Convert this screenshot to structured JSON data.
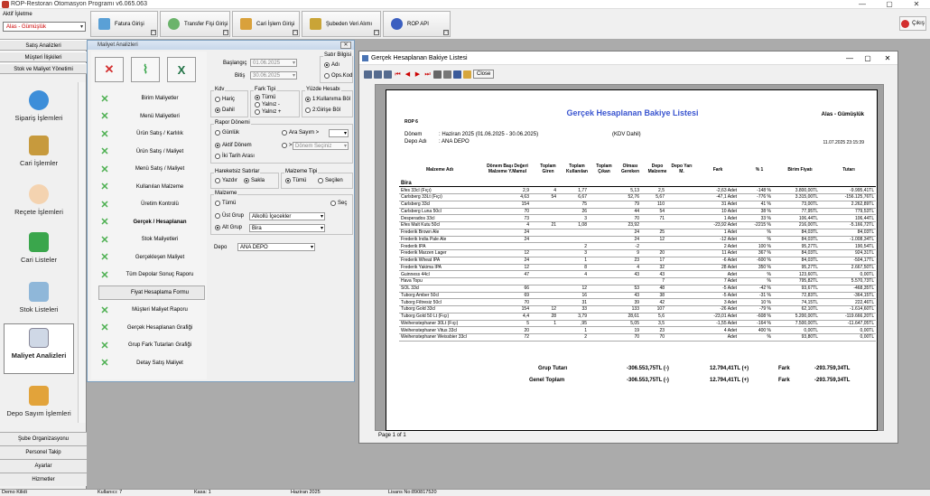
{
  "app": {
    "title": "ROP-Restoran Otomasyon Programı v6.065.063",
    "min_icon": "—",
    "max_icon": "▢",
    "close_icon": "✕"
  },
  "topbar": {
    "branch_label": "Aktif İşletme",
    "branch_value": "Alas - Gümüşlük",
    "buttons": [
      "Fatura Girişi",
      "Transfer Fişi Girişi",
      "Cari İşlem Girişi",
      "Şubeden Veri Alımı",
      "ROP API"
    ],
    "exit": "Çıkış"
  },
  "left": {
    "headers": [
      "Satış Analizleri",
      "Müşteri İlişkileri",
      "Stok ve Maliyet Yönetimi"
    ],
    "modules": [
      "Sipariş İşlemleri",
      "Cari İşlemler",
      "Reçete İşlemleri",
      "Cari Listeler",
      "Stok Listeleri",
      "Maliyet Analizleri",
      "Depo Sayım İşlemleri"
    ],
    "bottom": [
      "Şube Organizasyonu",
      "Personel Takip",
      "Ayarlar",
      "Hizmetler"
    ]
  },
  "dialog": {
    "title": "Maliyet Analizleri",
    "menu": [
      "Birim Maliyetler",
      "Menü Maliyetleri",
      "Ürün Satış / Karlılık",
      "Ürün Satış / Maliyet",
      "Menü Satış / Maliyet",
      "Kullanılan Malzeme",
      "Üretim Kontrolü",
      "Gerçek / Hesaplanan",
      "Stok Maliyetleri",
      "Gerçekleşen Maliyet",
      "Tüm Depolar Sonuç Raporu",
      "Fiyat Hesaplama Formu",
      "Müşteri Maliyet Raporu",
      "Gerçek Hesaplanan Grafiği",
      "Grup Fark Tutarları Grafiği",
      "Detay Satış Maliyet"
    ],
    "baslangic_label": "Başlangıç",
    "baslangic": "01.06.2025",
    "bitis_label": "Bitiş",
    "bitis": "30.06.2025",
    "satir_bilgisi": "Satır Bilgisi",
    "adi": "Adı",
    "ops_kod": "Ops.Kod",
    "kdv": "Kdv",
    "haric": "Hariç",
    "dahil": "Dahil",
    "fark_tipi": "Fark Tipi",
    "tumu": "Tümü",
    "yalniz_minus": "Yalnız -",
    "yalniz_plus": "Yalnız +",
    "yuzde": "Yüzde Hesabı",
    "kullanima": "1:Kullanıma Böl",
    "girise": "2:Girişe Böl",
    "rapor_donemi": "Rapor Dönemi",
    "gunluk": "Günlük",
    "ara_sayim": "Ara Sayım >",
    "aktif_donem": "Aktif Dönem",
    "donem_seciniz": "Dönem Seçiniz",
    "iki_tarih": "İki Tarih Arası",
    "hareketsiz": "Hareketsiz Satırlar",
    "yazdir": "Yazdır",
    "sakla": "Sakla",
    "malzeme_tipi": "Malzeme Tipi",
    "tumu2": "Tümü",
    "secilen": "Seçilen",
    "malzeme": "Malzeme",
    "tumu3": "Tümü",
    "sec": "Seç",
    "ust_grup": "Üst Grup",
    "ust_grup_val": "Alkollü İçecekler",
    "alt_grup": "Alt Grup",
    "alt_grup_val": "Bira",
    "depo_label": "Depo",
    "depo_val": "ANA DEPO"
  },
  "report_window": {
    "title": "Gerçek Hesaplanan Bakiye Listesi",
    "close_btn": "Close",
    "status": "Page 1 of 1",
    "sheet": {
      "title": "Gerçek Hesaplanan Bakiye Listesi",
      "company": "Alas - Gümüşlük",
      "code": "ROP 6",
      "donem_label": "Dönem",
      "donem_val": ": Haziran 2025 (01.06.2025 - 30.06.2025)",
      "kdv": "(KDV Dahil)",
      "depo_label": "Depo Adı",
      "depo_val": ": ANA DEPO",
      "date": "11.07.2025 23:15:39",
      "headers": [
        "Malzeme Adı",
        "Dönem Başı Değeri Malzeme Y.Mamul",
        "Toplam Giren",
        "Toplam Kullanılan",
        "Toplam Çıkan",
        "Olması Gereken",
        "Depo Malzeme",
        "Depo Yarı M.",
        "Fark",
        "% 1",
        "Birim Fiyatı",
        "Tutarı"
      ],
      "group": "Bira",
      "rows": [
        [
          "Efes 33cl (Fıçı)",
          "2,9",
          "4",
          "1,77",
          "",
          "5,13",
          "2,5",
          "",
          "-2,63 Adet",
          "-148 %",
          "3.800,00TL",
          "-9.995,41TL"
        ],
        [
          "Carlsberg 33Lt (Fıçı)",
          "4,63",
          "54",
          "6,67",
          "",
          "52,76",
          "5,67",
          "",
          "-47,1 Adet",
          "-776 %",
          "3.315,00TL",
          "-156.125,76TL"
        ],
        [
          "Carlsberg 33cl",
          "154",
          "",
          "75",
          "",
          "79",
          "110",
          "",
          "31 Adet",
          "41 %",
          "73,00TL",
          "2.262,89TL"
        ],
        [
          "Carlsberg Luna 50cl",
          "70",
          "",
          "26",
          "",
          "44",
          "54",
          "",
          "10 Adet",
          "38 %",
          "77,95TL",
          "779,53TL"
        ],
        [
          "Desperados 33cl",
          "73",
          "",
          "3",
          "",
          "70",
          "71",
          "",
          "1 Adet",
          "33 %",
          "106,44TL",
          "106,44TL"
        ],
        [
          "Efes Malt Kutu 50cl",
          "4",
          "21",
          "1,08",
          "",
          "23,92",
          "",
          "",
          "-23,92 Adet",
          "-2215 %",
          "216,00TL",
          "-5.166,72TL"
        ],
        [
          "Frederik Brown Ale",
          "24",
          "",
          "",
          "",
          "24",
          "25",
          "",
          "1 Adet",
          "%",
          "84,03TL",
          "84,03TL"
        ],
        [
          "Frederik India Pale Ale",
          "24",
          "",
          "",
          "",
          "24",
          "12",
          "",
          "-12 Adet",
          "%",
          "84,03TL",
          "-1.008,34TL"
        ],
        [
          "Frederik IPA",
          "",
          "",
          "2",
          "",
          "-2",
          "",
          "",
          "2 Adet",
          "100 %",
          "95,27TL",
          "190,54TL"
        ],
        [
          "Frederik Marzen Lager",
          "12",
          "",
          "3",
          "",
          "9",
          "20",
          "",
          "11 Adet",
          "367 %",
          "84,03TL",
          "924,31TL"
        ],
        [
          "Frederik Wheat IPA",
          "24",
          "",
          "1",
          "",
          "23",
          "17",
          "",
          "-6 Adet",
          "-600 %",
          "84,03TL",
          "-504,17TL"
        ],
        [
          "Frederik Yakima IPA",
          "12",
          "",
          "8",
          "",
          "4",
          "32",
          "",
          "28 Adet",
          "350 %",
          "95,27TL",
          "2.667,50TL"
        ],
        [
          "Guinness 44cl",
          "47",
          "",
          "4",
          "",
          "43",
          "43",
          "",
          "Adet",
          "%",
          "123,60TL",
          "0,00TL"
        ],
        [
          "Hava Topu",
          "",
          "",
          "",
          "",
          "",
          "7",
          "",
          "7 Adet",
          "%",
          "795,82TL",
          "5.570,73TL"
        ],
        [
          "SOL 33cl",
          "66",
          "",
          "12",
          "",
          "53",
          "48",
          "",
          "-5 Adet",
          "-42 %",
          "93,67TL",
          "-468,35TL"
        ],
        [
          "Tuborg Amber 50cl",
          "69",
          "",
          "16",
          "",
          "43",
          "38",
          "",
          "-5 Adet",
          "-31 %",
          "72,83TL",
          "-364,15TL"
        ],
        [
          "Tuborg Filtresiz 50cl",
          "70",
          "",
          "31",
          "",
          "39",
          "42",
          "",
          "3 Adet",
          "10 %",
          "74,15TL",
          "222,46TL"
        ],
        [
          "Tuborg Gold 33cl",
          "154",
          "12",
          "33",
          "",
          "133",
          "107",
          "",
          "-26 Adet",
          "-79 %",
          "62,10TL",
          "-1.614,60TL"
        ],
        [
          "Tuborg Gold 50 Lt (Fıçı)",
          "4,4",
          "28",
          "3,79",
          "",
          "28,61",
          "5,6",
          "",
          "-23,01 Adet",
          "-608 %",
          "5.200,00TL",
          "-119.666,20TL"
        ],
        [
          "Weihenstephaner 30Lt (Fıçı)",
          "5",
          "1",
          ",95",
          "",
          "5,05",
          "3,5",
          "",
          "-1,55 Adet",
          "-164 %",
          "7.500,00TL",
          "-11.647,05TL"
        ],
        [
          "Weihenstephaner Vitus 33cl",
          "20",
          "",
          "1",
          "",
          "19",
          "23",
          "",
          "4 Adet",
          "400 %",
          "0,00TL",
          "0,00TL"
        ],
        [
          "Weihenstephaner Weissbier 33cl",
          "72",
          "",
          "2",
          "",
          "70",
          "70",
          "",
          "Adet",
          "%",
          "93,80TL",
          "0,00TL"
        ]
      ],
      "grup_tutari_label": "Grup Tutarı",
      "grup_tutari_neg": "-306.553,75TL (-)",
      "grup_tutari_pos": "12.794,41TL (+)",
      "fark_label": "Fark",
      "grup_fark": "-293.759,34TL",
      "genel_label": "Genel Toplam",
      "genel_neg": "-306.553,75TL (-)",
      "genel_pos": "12.794,41TL (+)",
      "genel_fark_label": "Fark",
      "genel_fark": "-293.759,34TL"
    }
  },
  "statusbar": [
    "Demo Kilidi",
    "Kullanıcı: 7",
    "Kasa: 1",
    "Haziran 2025",
    "Lisans No:890817520"
  ],
  "colors": {
    "accent": "#3a55d0",
    "exit": "#d32f2f"
  }
}
